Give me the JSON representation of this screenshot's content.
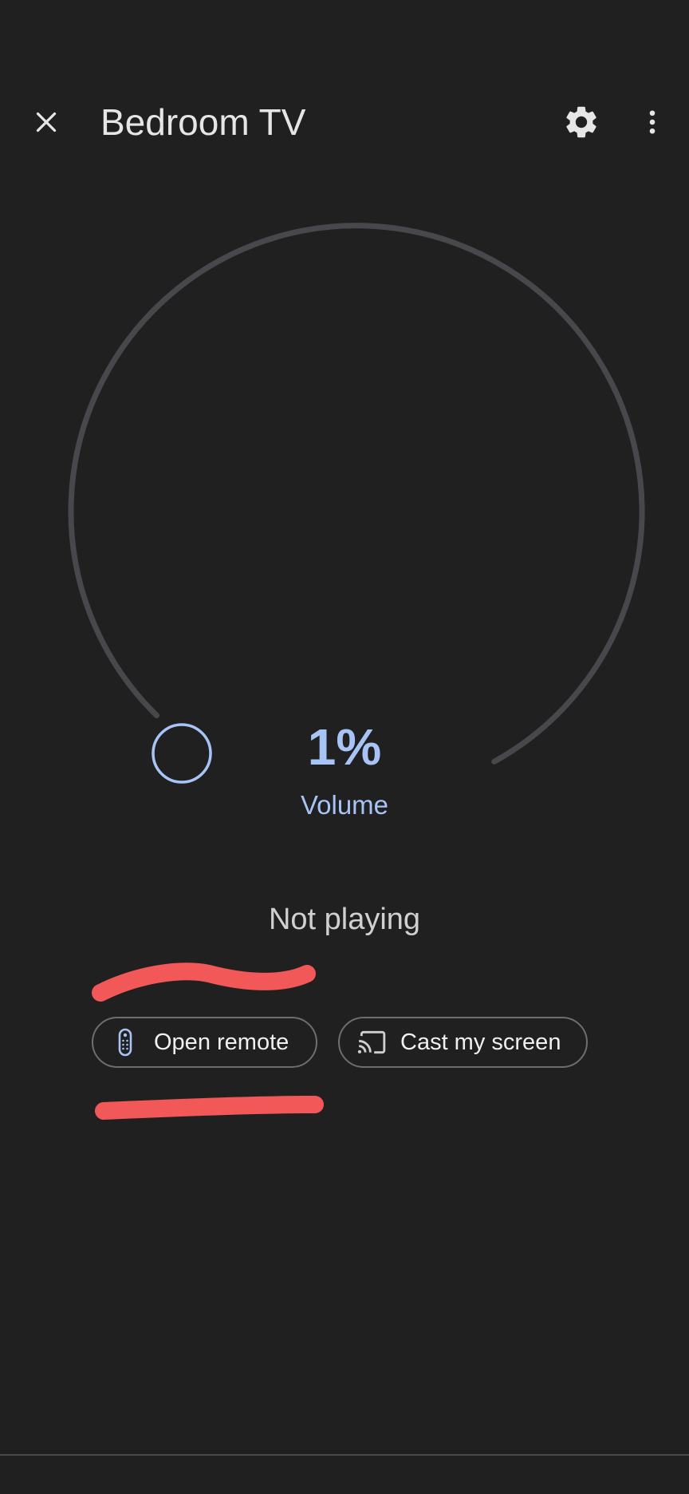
{
  "header": {
    "title": "Bedroom TV",
    "close_icon": "close-icon",
    "settings_icon": "gear-icon",
    "more_icon": "more-vert-icon"
  },
  "volume": {
    "value_text": "1%",
    "label": "Volume",
    "level": 0.01
  },
  "player": {
    "status": "Not playing"
  },
  "actions": {
    "open_remote_label": "Open remote",
    "open_remote_icon": "remote-icon",
    "cast_screen_label": "Cast my screen",
    "cast_screen_icon": "cast-icon"
  },
  "colors": {
    "background": "#202020",
    "accent": "#a8c4f6",
    "dial_track": "#48484c",
    "annotation": "#f25858"
  }
}
